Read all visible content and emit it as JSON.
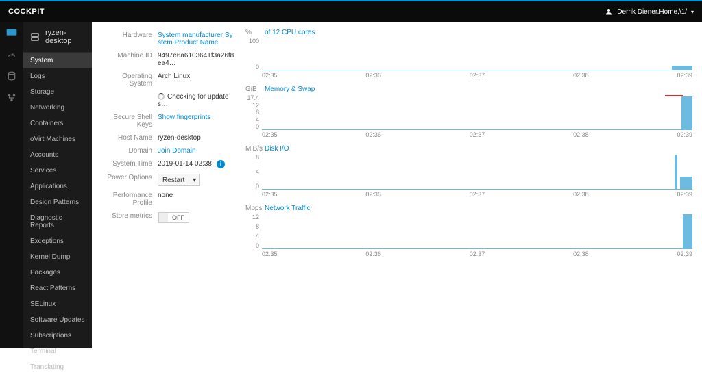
{
  "brand": "COCKPIT",
  "user": {
    "icon": "user-icon",
    "name": "Derrik Diener.Home,\\1/"
  },
  "rail": [
    {
      "name": "dashboard-icon",
      "active": true
    },
    {
      "name": "gauge-icon",
      "active": false
    },
    {
      "name": "storage-icon",
      "active": false
    },
    {
      "name": "network-icon",
      "active": false
    }
  ],
  "host": {
    "name": "ryzen-desktop"
  },
  "sidebar": {
    "items": [
      {
        "label": "System",
        "active": true
      },
      {
        "label": "Logs"
      },
      {
        "label": "Storage"
      },
      {
        "label": "Networking"
      },
      {
        "label": "Containers"
      },
      {
        "label": "oVirt Machines"
      },
      {
        "label": "Accounts"
      },
      {
        "label": "Services"
      },
      {
        "label": "Applications"
      },
      {
        "label": "Design Patterns"
      },
      {
        "label": "Diagnostic Reports"
      },
      {
        "label": "Exceptions"
      },
      {
        "label": "Kernel Dump"
      },
      {
        "label": "Packages"
      },
      {
        "label": "React Patterns"
      },
      {
        "label": "SELinux"
      },
      {
        "label": "Software Updates"
      },
      {
        "label": "Subscriptions"
      },
      {
        "label": "Terminal"
      },
      {
        "label": "Translating"
      }
    ]
  },
  "info": {
    "hardware": {
      "label": "Hardware",
      "value": "System manufacturer System Product Name",
      "link": true
    },
    "machine_id": {
      "label": "Machine ID",
      "value": "9497e6a6103641f3a26f8ea4…"
    },
    "os": {
      "label": "Operating System",
      "value": "Arch Linux"
    },
    "updates": {
      "label": "",
      "value": "Checking for updates…"
    },
    "ssh": {
      "label": "Secure Shell Keys",
      "value": "Show fingerprints",
      "link": true
    },
    "hostname": {
      "label": "Host Name",
      "value": "ryzen-desktop"
    },
    "domain": {
      "label": "Domain",
      "value": "Join Domain",
      "link": true
    },
    "time": {
      "label": "System Time",
      "value": "2019-01-14 02:38"
    },
    "power": {
      "label": "Power Options",
      "value": "Restart"
    },
    "profile": {
      "label": "Performance Profile",
      "value": "none"
    },
    "metrics": {
      "label": "Store metrics",
      "value": "OFF"
    }
  },
  "charts": {
    "ticks": [
      "02:35",
      "02:36",
      "02:37",
      "02:38",
      "02:39"
    ],
    "cpu": {
      "unit": "%",
      "title": "of 12 CPU cores",
      "ymax": "100",
      "ymin": "0",
      "height": 48
    },
    "mem": {
      "unit": "GiB",
      "title": "Memory & Swap",
      "ymax": "17.4",
      "ymid1": "12",
      "ymid2": "8",
      "ymid3": "4",
      "ymin": "0",
      "height": 52
    },
    "disk": {
      "unit": "MiB/s",
      "title": "Disk I/O",
      "ymax": "8",
      "ymid": "4",
      "ymin": "0",
      "height": 52
    },
    "net": {
      "unit": "Mbps",
      "title": "Network Traffic",
      "ymax": "12",
      "ymid1": "8",
      "ymid2": "4",
      "ymin": "0",
      "height": 52
    }
  },
  "chart_data": [
    {
      "type": "area",
      "title": "% of 12 CPU cores",
      "xlabel": "",
      "ylabel": "%",
      "ylim": [
        0,
        100
      ],
      "x_ticks": [
        "02:35",
        "02:36",
        "02:37",
        "02:38",
        "02:39"
      ],
      "series": [
        {
          "name": "cpu",
          "values_est": "≈2% baseline rising to ≈8% spike near 02:39"
        }
      ]
    },
    {
      "type": "area",
      "title": "Memory & Swap (GiB)",
      "xlabel": "",
      "ylabel": "GiB",
      "ylim": [
        0,
        17.4
      ],
      "x_ticks": [
        "02:35",
        "02:36",
        "02:37",
        "02:38",
        "02:39"
      ],
      "series": [
        {
          "name": "memory",
          "values_est": "≈0 until 02:38.5 then step to ≈16 GiB"
        },
        {
          "name": "swap",
          "values_est": "short ≈17 GiB red marker near 02:39"
        }
      ]
    },
    {
      "type": "area",
      "title": "Disk I/O (MiB/s)",
      "xlabel": "",
      "ylabel": "MiB/s",
      "ylim": [
        0,
        8
      ],
      "x_ticks": [
        "02:35",
        "02:36",
        "02:37",
        "02:38",
        "02:39"
      ],
      "series": [
        {
          "name": "disk",
          "values_est": "≈0 with narrow spike to ≈8 MiB/s around 02:38.5, then ≈2–4"
        }
      ]
    },
    {
      "type": "area",
      "title": "Network Traffic (Mbps)",
      "xlabel": "",
      "ylabel": "Mbps",
      "ylim": [
        0,
        12
      ],
      "x_ticks": [
        "02:35",
        "02:36",
        "02:37",
        "02:38",
        "02:39"
      ],
      "series": [
        {
          "name": "net",
          "values_est": "≈0 until ~02:38.7 then spike to ≈12 Mbps"
        }
      ]
    }
  ]
}
